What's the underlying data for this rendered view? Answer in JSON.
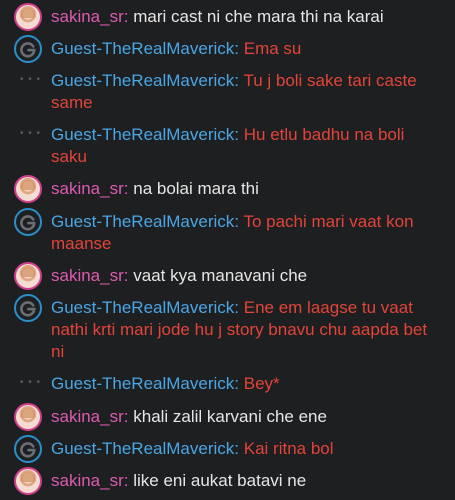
{
  "colors": {
    "background": "#1e1f21",
    "sakina_name": "#dc5bb0",
    "guest_name": "#4aa6e4",
    "sakina_text": "#e6e6e6",
    "guest_text": "#e2443a"
  },
  "icons": {
    "sakina_avatar": "avatar-photo-icon",
    "guest_avatar": "guest-g-icon",
    "continuation": "ellipsis-icon"
  },
  "separator": ":",
  "messages": [
    {
      "user": "sakina_sr",
      "text": "mari cast ni che mara thi na karai"
    },
    {
      "user": "Guest-TheRealMaverick",
      "text": "Ema su"
    },
    {
      "user": "Guest-TheRealMaverick",
      "text": "Tu j boli sake tari caste same"
    },
    {
      "user": "Guest-TheRealMaverick",
      "text": "Hu etlu badhu na boli saku"
    },
    {
      "user": "sakina_sr",
      "text": "na bolai mara thi"
    },
    {
      "user": "Guest-TheRealMaverick",
      "text": "To pachi mari vaat kon maanse"
    },
    {
      "user": "sakina_sr",
      "text": "vaat kya manavani che"
    },
    {
      "user": "Guest-TheRealMaverick",
      "text": "Ene em laagse tu vaat nathi krti mari jode hu j story bnavu chu aapda bet ni"
    },
    {
      "user": "Guest-TheRealMaverick",
      "text": "Bey*"
    },
    {
      "user": "sakina_sr",
      "text": "khali zalil karvani che ene"
    },
    {
      "user": "Guest-TheRealMaverick",
      "text": "Kai ritna bol"
    },
    {
      "user": "sakina_sr",
      "text": "like eni aukat batavi ne"
    }
  ]
}
